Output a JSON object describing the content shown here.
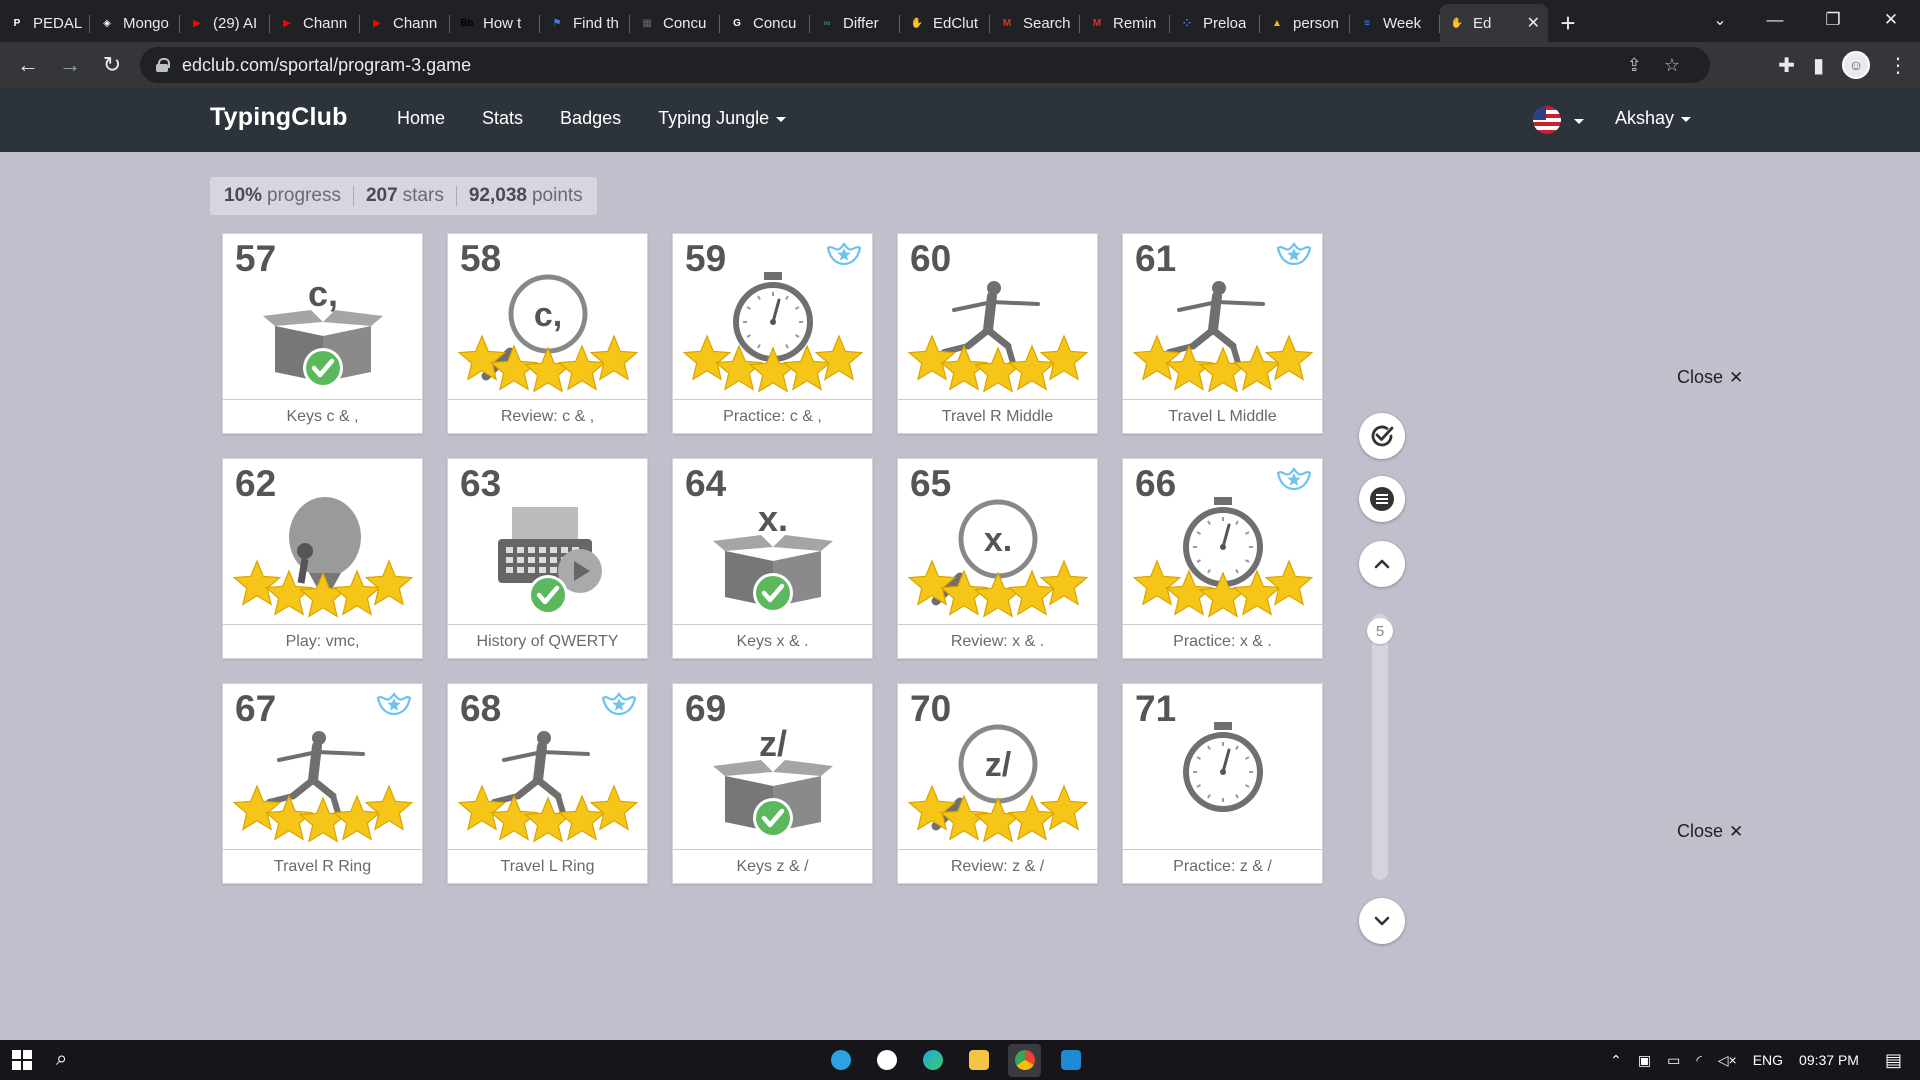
{
  "browser": {
    "tabs": [
      {
        "title": "PEDAL",
        "favicon_color": "#ffffff",
        "glyph": "P"
      },
      {
        "title": "Mongo",
        "favicon_color": "#ffffff",
        "glyph": "◈"
      },
      {
        "title": "(29) AI",
        "favicon_color": "#ff0000",
        "glyph": "▶"
      },
      {
        "title": "Chann",
        "favicon_color": "#ff0000",
        "glyph": "▶"
      },
      {
        "title": "Chann",
        "favicon_color": "#ff0000",
        "glyph": "▶"
      },
      {
        "title": "How t",
        "favicon_color": "#000000",
        "glyph": "Bb"
      },
      {
        "title": "Find th",
        "favicon_color": "#4a7dd6",
        "glyph": "⚑"
      },
      {
        "title": "Concu",
        "favicon_color": "#666666",
        "glyph": "▦"
      },
      {
        "title": "Concu",
        "favicon_color": "#ffffff",
        "glyph": "G"
      },
      {
        "title": "Differ",
        "favicon_color": "#2e8b57",
        "glyph": "∞"
      },
      {
        "title": "EdClut",
        "favicon_color": "#f28c28",
        "glyph": "✋"
      },
      {
        "title": "Search",
        "favicon_color": "#d93025",
        "glyph": "M"
      },
      {
        "title": "Remin",
        "favicon_color": "#d93025",
        "glyph": "M"
      },
      {
        "title": "Preloa",
        "favicon_color": "#4a90e2",
        "glyph": "⁘"
      },
      {
        "title": "person",
        "favicon_color": "#fbbc04",
        "glyph": "▲"
      },
      {
        "title": "Week",
        "favicon_color": "#4285f4",
        "glyph": "≡"
      },
      {
        "title": "Ed",
        "favicon_color": "#f28c28",
        "glyph": "✋",
        "active": true
      }
    ],
    "url": "edclub.com/sportal/program-3.game",
    "newtab": "+",
    "close_tab": "✕"
  },
  "app": {
    "brand": "TypingClub",
    "nav": [
      "Home",
      "Stats",
      "Badges",
      "Typing Jungle"
    ],
    "user": "Akshay"
  },
  "progress": {
    "percent": "10%",
    "percent_label": "progress",
    "stars": "207",
    "stars_label": "stars",
    "points": "92,038",
    "points_label": "points"
  },
  "lessons": [
    {
      "num": "57",
      "label": "Keys c & ,",
      "art": "box",
      "glyph": "c,",
      "stars": 0,
      "check": true,
      "badge": false
    },
    {
      "num": "58",
      "label": "Review: c & ,",
      "art": "magnifier",
      "glyph": "c,",
      "stars": 5,
      "check": false,
      "badge": false
    },
    {
      "num": "59",
      "label": "Practice: c & ,",
      "art": "stopwatch",
      "glyph": "",
      "stars": 5,
      "check": false,
      "badge": true
    },
    {
      "num": "60",
      "label": "Travel R Middle",
      "art": "runner",
      "glyph": "",
      "stars": 5,
      "check": false,
      "badge": false
    },
    {
      "num": "61",
      "label": "Travel L Middle",
      "art": "runner",
      "glyph": "",
      "stars": 5,
      "check": false,
      "badge": true
    },
    {
      "num": "62",
      "label": "Play: vmc,",
      "art": "balloon",
      "glyph": "",
      "stars": 5,
      "check": false,
      "badge": false
    },
    {
      "num": "63",
      "label": "History of QWERTY",
      "art": "typewriter",
      "glyph": "",
      "stars": 0,
      "check": true,
      "badge": false
    },
    {
      "num": "64",
      "label": "Keys x & .",
      "art": "box",
      "glyph": "x.",
      "stars": 0,
      "check": true,
      "badge": false
    },
    {
      "num": "65",
      "label": "Review: x & .",
      "art": "magnifier",
      "glyph": "x.",
      "stars": 5,
      "check": false,
      "badge": false
    },
    {
      "num": "66",
      "label": "Practice: x & .",
      "art": "stopwatch",
      "glyph": "",
      "stars": 5,
      "check": false,
      "badge": true
    },
    {
      "num": "67",
      "label": "Travel R Ring",
      "art": "runner",
      "glyph": "",
      "stars": 5,
      "check": false,
      "badge": true
    },
    {
      "num": "68",
      "label": "Travel L Ring",
      "art": "runner",
      "glyph": "",
      "stars": 5,
      "check": false,
      "badge": true
    },
    {
      "num": "69",
      "label": "Keys z & /",
      "art": "box",
      "glyph": "z/",
      "stars": 0,
      "check": true,
      "badge": false
    },
    {
      "num": "70",
      "label": "Review: z & /",
      "art": "magnifier",
      "glyph": "z/",
      "stars": 5,
      "check": false,
      "badge": false
    },
    {
      "num": "71",
      "label": "Practice: z & /",
      "art": "stopwatch",
      "glyph": "",
      "stars": 0,
      "check": false,
      "badge": false
    }
  ],
  "side": {
    "scroll_level": "5",
    "close_label": "Close",
    "close_glyph": "✕"
  },
  "taskbar": {
    "lang": "ENG",
    "time": "09:37 PM"
  },
  "colors": {
    "star": "#f5c518",
    "check": "#5cb85c",
    "badge": "#6cc4ec",
    "nav_bg": "#2d333b",
    "page_bg": "#c0bfcc"
  }
}
